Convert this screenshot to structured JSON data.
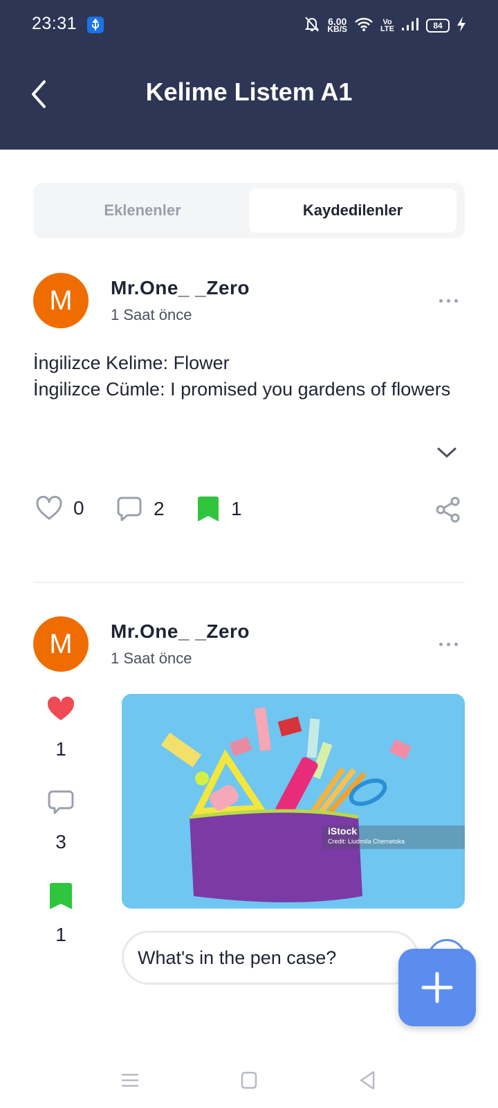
{
  "status_bar": {
    "time": "23:31",
    "net_speed_value": "6.00",
    "net_speed_unit": "KB/S",
    "network_label_top": "Vo",
    "network_label_bottom": "LTE",
    "battery": "84"
  },
  "header": {
    "title": "Kelime Listem A1"
  },
  "tabs": [
    {
      "label": "Eklenenler",
      "active": false
    },
    {
      "label": "Kaydedilenler",
      "active": true
    }
  ],
  "posts": [
    {
      "avatar_letter": "M",
      "username": "Mr.One_ _Zero",
      "time": "1 Saat önce",
      "text_line1": "İngilizce Kelime: Flower",
      "text_line2": "İngilizce Cümle: I promised you gardens of flowers",
      "likes": "0",
      "comments": "2",
      "saves": "1",
      "liked": false,
      "saved": true
    },
    {
      "avatar_letter": "M",
      "username": "Mr.One_ _Zero",
      "time": "1 Saat önce",
      "likes": "1",
      "comments": "3",
      "saves": "1",
      "liked": true,
      "saved": true,
      "image_watermark": "iStock",
      "image_credit": "Credit: Liudmila Chernetska",
      "question": "What's in the pen case?"
    }
  ],
  "colors": {
    "header_bg": "#2d3654",
    "avatar": "#ef6c00",
    "saved_green": "#2fc53d",
    "liked_red": "#ef4b55",
    "fab_blue": "#5b8def"
  },
  "icons": {
    "back": "chevron-left-icon",
    "more": "more-dots-icon",
    "expand": "chevron-down-icon",
    "like": "heart-icon",
    "comment": "comment-icon",
    "save": "bookmark-icon",
    "share": "share-icon",
    "fab": "plus-icon"
  }
}
